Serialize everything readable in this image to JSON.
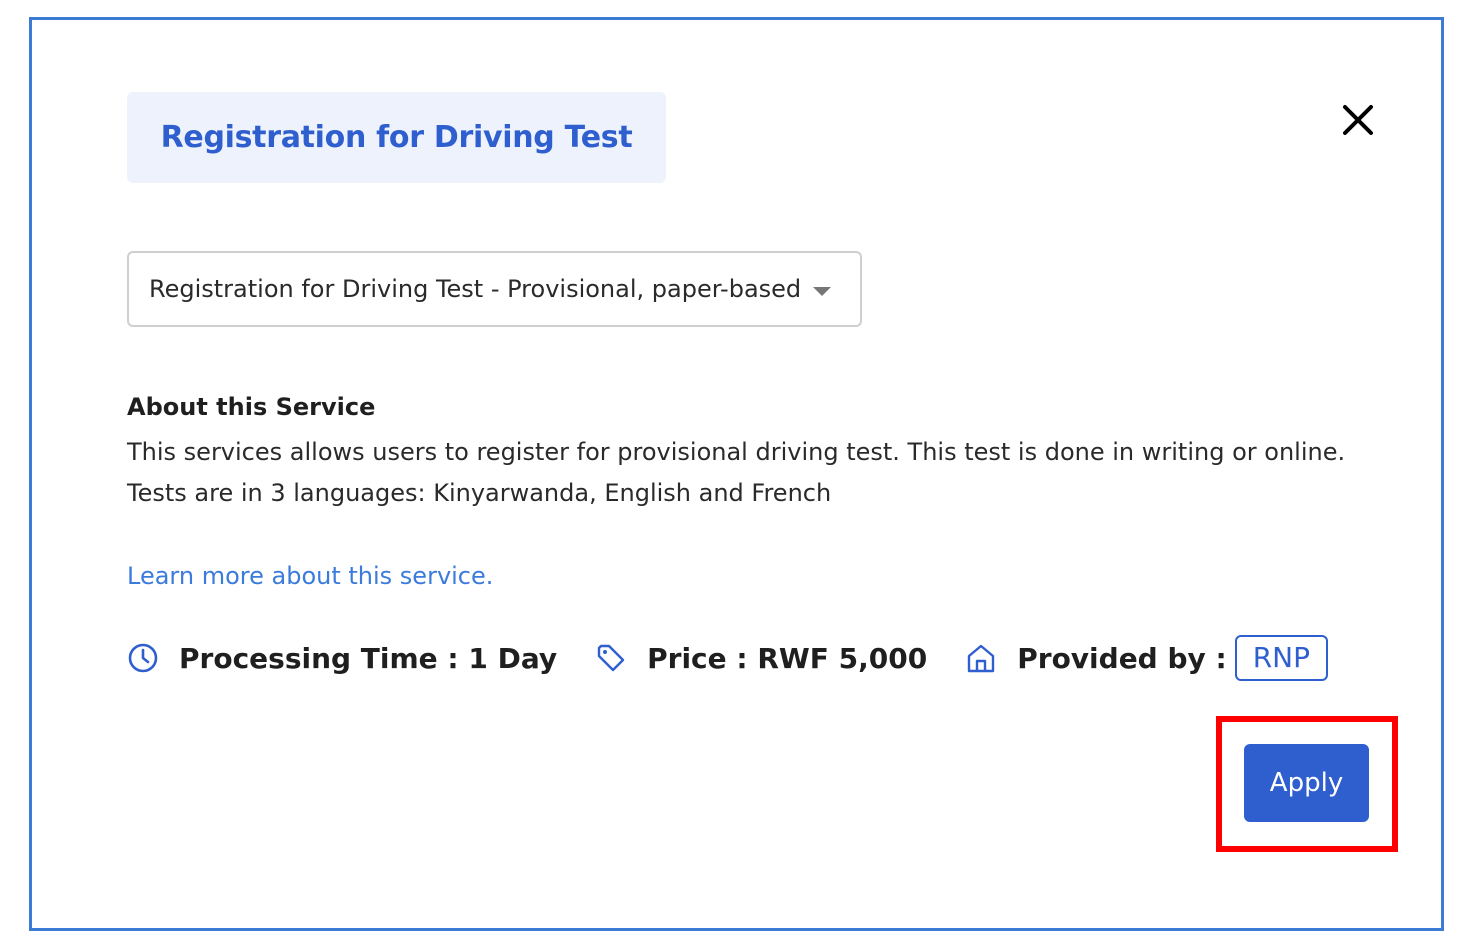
{
  "modal": {
    "title": "Registration for Driving Test",
    "service_select": {
      "value": "Registration for Driving Test - Provisional, paper-based"
    },
    "about": {
      "heading": "About this Service",
      "line1": "This services allows users to register for provisional driving test. This test is done in writing or online.",
      "line2": "Tests are in 3 languages: Kinyarwanda, English and French"
    },
    "learn_more": "Learn more about this service.",
    "meta": {
      "processing_time": "Processing Time : 1 Day",
      "price": "Price : RWF 5,000",
      "provided_by_label": "Provided by :",
      "provider": "RNP"
    },
    "apply_label": "Apply"
  },
  "icons": {
    "close": "close-icon",
    "select_caret": "chevron-down-icon",
    "processing": "clock-icon",
    "price": "tag-icon",
    "provider": "home-icon"
  },
  "colors": {
    "primary": "#2f5fcf",
    "link": "#3b7bdc",
    "chip_bg": "#edf2fc",
    "modal_border": "#3b7bd4",
    "highlight": "#ff0000"
  }
}
